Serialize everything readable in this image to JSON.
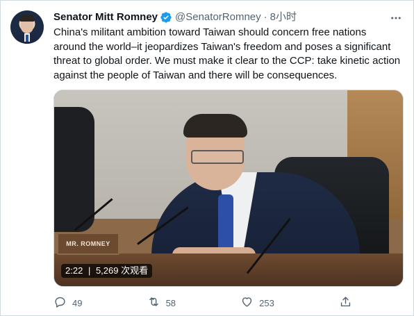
{
  "author": {
    "name": "Senator Mitt Romney",
    "handle": "@SenatorRomney",
    "separator": "·",
    "time": "8小时"
  },
  "tweet": {
    "text": "China's militant ambition toward Taiwan should concern free nations\naround the world–it jeopardizes Taiwan's freedom and poses a significant\nthreat to global order. We must make it clear to the CCP: take kinetic action\nagainst the people of Taiwan and there will be consequences."
  },
  "media": {
    "nameplate": "MR. ROMNEY",
    "duration": "2:22",
    "views": "5,269 次观看"
  },
  "actions": {
    "replies": "49",
    "retweets": "58",
    "likes": "253"
  },
  "icons": {
    "verified": "verified-badge-icon",
    "more": "more-icon",
    "reply": "reply-icon",
    "retweet": "retweet-icon",
    "like": "like-icon",
    "share": "share-icon"
  },
  "colors": {
    "verified": "#1d9bf0",
    "secondary_text": "#536471",
    "primary_text": "#0f1419",
    "border": "#cfd9de"
  }
}
